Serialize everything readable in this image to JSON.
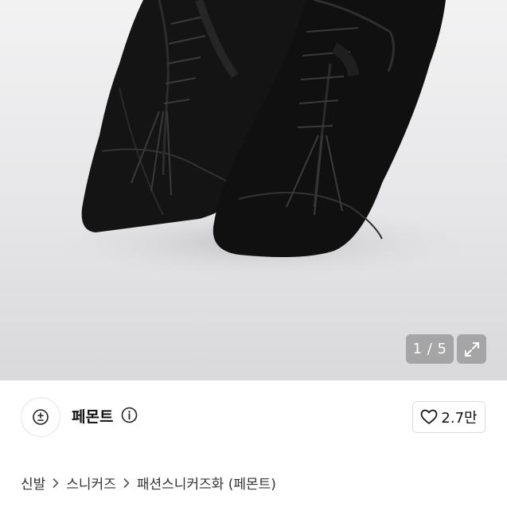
{
  "gallery": {
    "counter": "1 / 5",
    "expand_icon": "expand-icon"
  },
  "store": {
    "logo_icon": "plus-minus-icon",
    "name": "페몬트",
    "info_icon": "info-icon"
  },
  "like": {
    "icon": "heart-icon",
    "count": "2.7만"
  },
  "breadcrumb": {
    "items": [
      "신발",
      "스니커즈",
      "패션스니커즈화 (페몬트)"
    ]
  }
}
